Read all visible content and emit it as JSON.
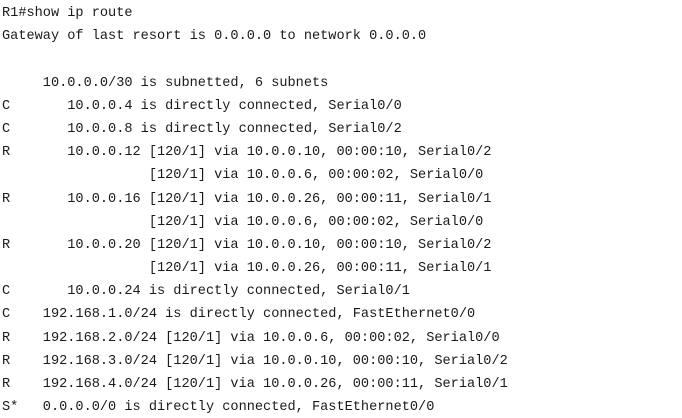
{
  "terminal": {
    "lines": [
      "R1#show ip route",
      "Gateway of last resort is 0.0.0.0 to network 0.0.0.0",
      "",
      "     10.0.0.0/30 is subnetted, 6 subnets",
      "C       10.0.0.4 is directly connected, Serial0/0",
      "C       10.0.0.8 is directly connected, Serial0/2",
      "R       10.0.0.12 [120/1] via 10.0.0.10, 00:00:10, Serial0/2",
      "                  [120/1] via 10.0.0.6, 00:00:02, Serial0/0",
      "R       10.0.0.16 [120/1] via 10.0.0.26, 00:00:11, Serial0/1",
      "                  [120/1] via 10.0.0.6, 00:00:02, Serial0/0",
      "R       10.0.0.20 [120/1] via 10.0.0.10, 00:00:10, Serial0/2",
      "                  [120/1] via 10.0.0.26, 00:00:11, Serial0/1",
      "C       10.0.0.24 is directly connected, Serial0/1",
      "C    192.168.1.0/24 is directly connected, FastEthernet0/0",
      "R    192.168.2.0/24 [120/1] via 10.0.0.6, 00:00:02, Serial0/0",
      "R    192.168.3.0/24 [120/1] via 10.0.0.10, 00:00:10, Serial0/2",
      "R    192.168.4.0/24 [120/1] via 10.0.0.26, 00:00:11, Serial0/1",
      "S*   0.0.0.0/0 is directly connected, FastEthernet0/0"
    ]
  }
}
